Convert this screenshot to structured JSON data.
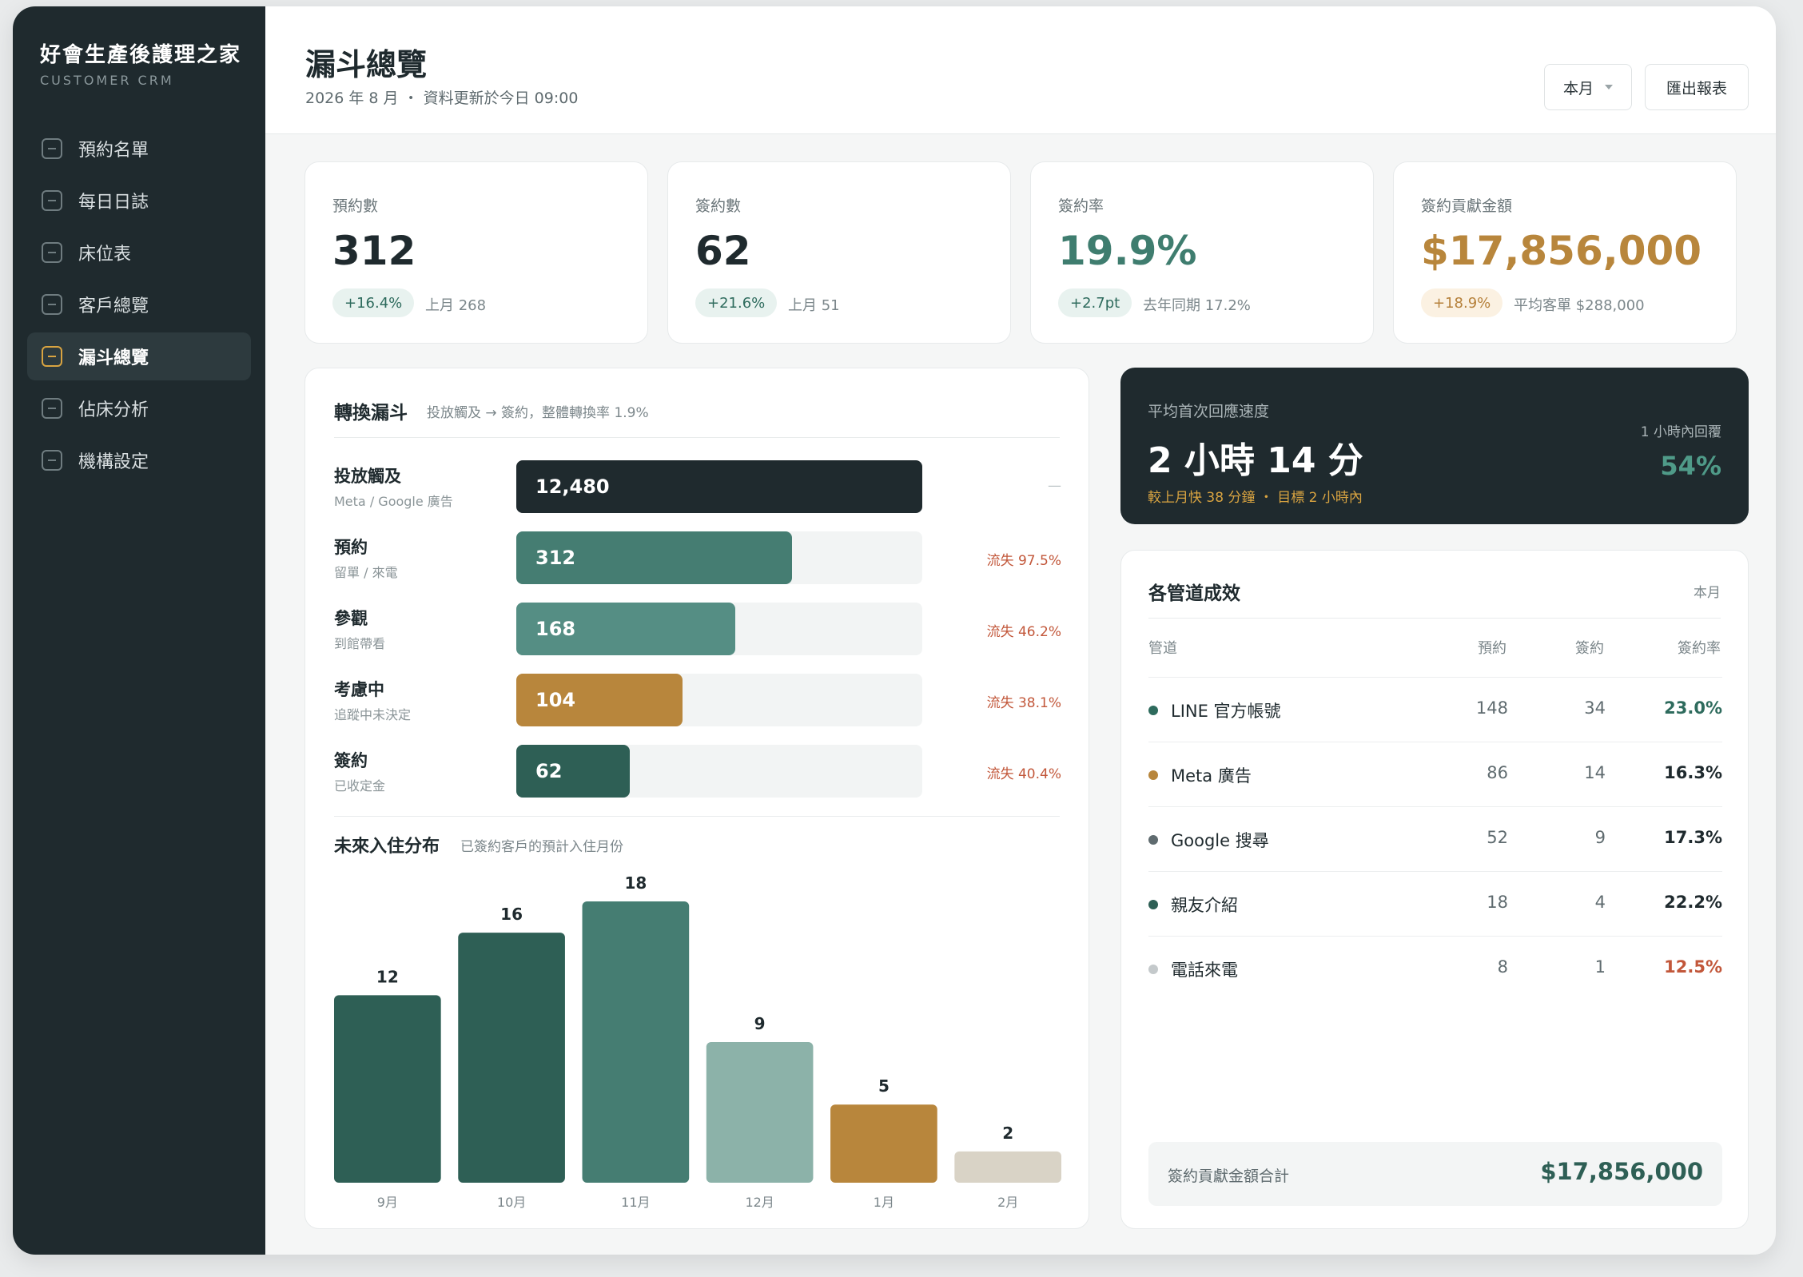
{
  "sidebar": {
    "brand_title": "好會生產後護理之家",
    "brand_sub": "CUSTOMER CRM",
    "items": [
      {
        "label": "預約名單",
        "active": false
      },
      {
        "label": "每日日誌",
        "active": false
      },
      {
        "label": "床位表",
        "active": false
      },
      {
        "label": "客戶總覽",
        "active": false
      },
      {
        "label": "漏斗總覽",
        "active": true
      },
      {
        "label": "佔床分析",
        "active": false
      },
      {
        "label": "機構設定",
        "active": false
      }
    ]
  },
  "header": {
    "title": "漏斗總覽",
    "subtitle": "2026 年 8 月 ・ 資料更新於今日 09:00",
    "period_label": "本月",
    "export_label": "匯出報表"
  },
  "kpis": [
    {
      "label": "預約數",
      "value": "312",
      "badge": "+16.4%",
      "note": "上月 268"
    },
    {
      "label": "簽約數",
      "value": "62",
      "badge": "+21.6%",
      "note": "上月 51"
    },
    {
      "label": "簽約率",
      "value": "19.9%",
      "badge": "+2.7pt",
      "note": "去年同期 17.2%"
    },
    {
      "label": "簽約貢獻金額",
      "value": "$17,856,000",
      "badge": "+18.9%",
      "note": "平均客單 $288,000"
    }
  ],
  "funnel": {
    "title": "轉換漏斗",
    "subtitle": "投放觸及 → 簽約，整體轉換率 1.9%",
    "stages": [
      {
        "name": "投放觸及",
        "desc": "Meta / Google 廣告",
        "value": "12,480",
        "fill": 1.0,
        "loss": "—",
        "color": "#1f2a2e"
      },
      {
        "name": "預約",
        "desc": "留單 / 來電",
        "value": "312",
        "fill": 0.68,
        "loss": "流失 97.5%",
        "color": "#457d72"
      },
      {
        "name": "參觀",
        "desc": "到館帶看",
        "value": "168",
        "fill": 0.54,
        "loss": "流失 46.2%",
        "color": "#558e84"
      },
      {
        "name": "考慮中",
        "desc": "追蹤中未決定",
        "value": "104",
        "fill": 0.41,
        "loss": "流失 38.1%",
        "color": "#b8863c"
      },
      {
        "name": "簽約",
        "desc": "已收定金",
        "value": "62",
        "fill": 0.28,
        "loss": "流失 40.4%",
        "color": "#2e5f55"
      }
    ]
  },
  "move_in": {
    "title": "未來入住分布",
    "subtitle": "已簽約客戶的預計入住月份"
  },
  "chart_data": {
    "type": "bar",
    "categories": [
      "9月",
      "10月",
      "11月",
      "12月",
      "1月",
      "2月"
    ],
    "values": [
      12,
      16,
      18,
      9,
      5,
      2
    ],
    "colors": [
      "#2e5f55",
      "#2e5f55",
      "#457d72",
      "#8cb2a9",
      "#b8863c",
      "#d9d3c6"
    ],
    "title": "未來入住分布",
    "ylim": [
      0,
      18
    ]
  },
  "response": {
    "label": "平均首次回應速度",
    "value": "2 小時 14 分",
    "note": "較上月快 38 分鐘 ・ 目標 2 小時內",
    "right_label": "1 小時內回覆",
    "right_value": "54%"
  },
  "channels": {
    "title": "各管道成效",
    "period": "本月",
    "headers": {
      "channel": "管道",
      "booked": "預約",
      "signed": "簽約",
      "rate": "簽約率"
    },
    "rows": [
      {
        "name": "LINE 官方帳號",
        "booked": "148",
        "signed": "34",
        "rate": "23.0%",
        "dot": "#2e6b5d",
        "rate_color": "#2e6b5d"
      },
      {
        "name": "Meta 廣告",
        "booked": "86",
        "signed": "14",
        "rate": "16.3%",
        "dot": "#b8863c",
        "rate_color": "#1f2a2e"
      },
      {
        "name": "Google 搜尋",
        "booked": "52",
        "signed": "9",
        "rate": "17.3%",
        "dot": "#5f6b6f",
        "rate_color": "#1f2a2e"
      },
      {
        "name": "親友介紹",
        "booked": "18",
        "signed": "4",
        "rate": "22.2%",
        "dot": "#2e5f55",
        "rate_color": "#1f2a2e"
      },
      {
        "name": "電話來電",
        "booked": "8",
        "signed": "1",
        "rate": "12.5%",
        "dot": "#c4c9cb",
        "rate_color": "#c2573a"
      }
    ],
    "total_label": "簽約貢獻金額合計",
    "total_value": "$17,856,000"
  }
}
